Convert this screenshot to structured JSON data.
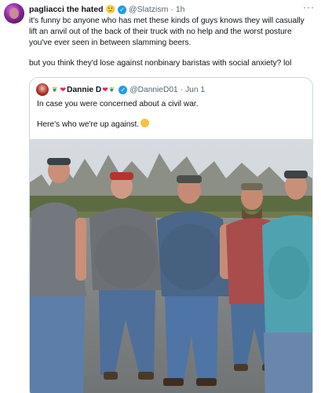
{
  "tweet": {
    "author_name": "pagliacci the hated",
    "author_emoji": "🙂",
    "handle": "@Slatzism",
    "separator": "·",
    "time": "1h",
    "more_label": "···",
    "text_paragraph_1": "it's funny bc anyone who has met these kinds of guys knows they will casually lift an anvil out of the back of their truck with no help and the worst posture you've ever seen in between slamming beers.",
    "text_paragraph_2": "but you think they'd lose against nonbinary baristas with social anxiety? lol"
  },
  "quoted_tweet": {
    "author_name": "Dannie D",
    "handle": "@DannieD01",
    "separator": "·",
    "time": "Jun 1",
    "line_1": "In case you were concerned about a civil war.",
    "line_2": "Here's who we're up against."
  },
  "colors": {
    "verified": "#1d9bf0",
    "secondary_text": "#536471",
    "border": "#cfd9de"
  },
  "icons": [
    "verified-badge-icon",
    "more-options-icon",
    "leaf-icon",
    "hearts-icon",
    "smirk-emoji-icon"
  ]
}
